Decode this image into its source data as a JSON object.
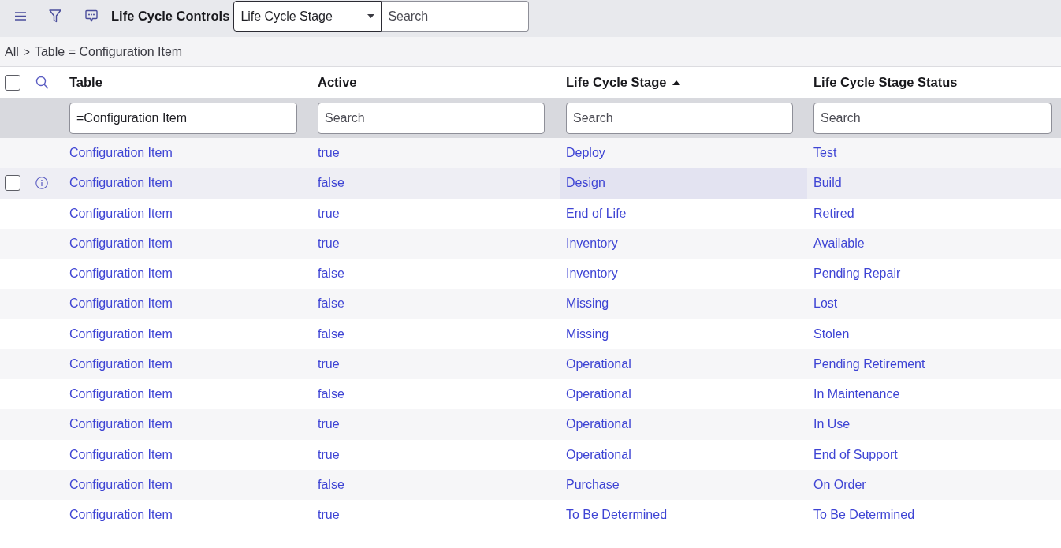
{
  "toolbar": {
    "title": "Life Cycle Controls",
    "field_select": {
      "value": "Life Cycle Stage"
    },
    "search": {
      "placeholder": "Search"
    }
  },
  "breadcrumb": {
    "items": [
      "All",
      "Table = Configuration Item"
    ],
    "separator": ">"
  },
  "table": {
    "select_all": {
      "checked": false
    },
    "columns": [
      {
        "label": "Table",
        "sorted": false
      },
      {
        "label": "Active",
        "sorted": false
      },
      {
        "label": "Life Cycle Stage",
        "sorted": true
      },
      {
        "label": "Life Cycle Stage Status",
        "sorted": false
      }
    ],
    "filters": [
      {
        "value": "=Configuration Item"
      },
      {
        "placeholder": "Search"
      },
      {
        "placeholder": "Search"
      },
      {
        "placeholder": "Search"
      }
    ],
    "rows": [
      {
        "shaded": true,
        "hovered": false,
        "checked": false,
        "cells": [
          {
            "text": "Configuration Item",
            "focused": false
          },
          {
            "text": "true",
            "focused": false
          },
          {
            "text": "Deploy",
            "focused": false
          },
          {
            "text": "Test",
            "focused": false
          }
        ]
      },
      {
        "shaded": true,
        "hovered": true,
        "checked": false,
        "cells": [
          {
            "text": "Configuration Item",
            "focused": false
          },
          {
            "text": "false",
            "focused": false
          },
          {
            "text": "Design",
            "focused": true
          },
          {
            "text": "Build",
            "focused": false
          }
        ]
      },
      {
        "shaded": false,
        "hovered": false,
        "checked": false,
        "cells": [
          {
            "text": "Configuration Item",
            "focused": false
          },
          {
            "text": "true",
            "focused": false
          },
          {
            "text": "End of Life",
            "focused": false
          },
          {
            "text": "Retired",
            "focused": false
          }
        ]
      },
      {
        "shaded": true,
        "hovered": false,
        "checked": false,
        "cells": [
          {
            "text": "Configuration Item",
            "focused": false
          },
          {
            "text": "true",
            "focused": false
          },
          {
            "text": "Inventory",
            "focused": false
          },
          {
            "text": "Available",
            "focused": false
          }
        ]
      },
      {
        "shaded": false,
        "hovered": false,
        "checked": false,
        "cells": [
          {
            "text": "Configuration Item",
            "focused": false
          },
          {
            "text": "false",
            "focused": false
          },
          {
            "text": "Inventory",
            "focused": false
          },
          {
            "text": "Pending Repair",
            "focused": false
          }
        ]
      },
      {
        "shaded": true,
        "hovered": false,
        "checked": false,
        "cells": [
          {
            "text": "Configuration Item",
            "focused": false
          },
          {
            "text": "false",
            "focused": false
          },
          {
            "text": "Missing",
            "focused": false
          },
          {
            "text": "Lost",
            "focused": false
          }
        ]
      },
      {
        "shaded": false,
        "hovered": false,
        "checked": false,
        "cells": [
          {
            "text": "Configuration Item",
            "focused": false
          },
          {
            "text": "false",
            "focused": false
          },
          {
            "text": "Missing",
            "focused": false
          },
          {
            "text": "Stolen",
            "focused": false
          }
        ]
      },
      {
        "shaded": true,
        "hovered": false,
        "checked": false,
        "cells": [
          {
            "text": "Configuration Item",
            "focused": false
          },
          {
            "text": "true",
            "focused": false
          },
          {
            "text": "Operational",
            "focused": false
          },
          {
            "text": "Pending Retirement",
            "focused": false
          }
        ]
      },
      {
        "shaded": false,
        "hovered": false,
        "checked": false,
        "cells": [
          {
            "text": "Configuration Item",
            "focused": false
          },
          {
            "text": "false",
            "focused": false
          },
          {
            "text": "Operational",
            "focused": false
          },
          {
            "text": "In Maintenance",
            "focused": false
          }
        ]
      },
      {
        "shaded": true,
        "hovered": false,
        "checked": false,
        "cells": [
          {
            "text": "Configuration Item",
            "focused": false
          },
          {
            "text": "true",
            "focused": false
          },
          {
            "text": "Operational",
            "focused": false
          },
          {
            "text": "In Use",
            "focused": false
          }
        ]
      },
      {
        "shaded": false,
        "hovered": false,
        "checked": false,
        "cells": [
          {
            "text": "Configuration Item",
            "focused": false
          },
          {
            "text": "true",
            "focused": false
          },
          {
            "text": "Operational",
            "focused": false
          },
          {
            "text": "End of Support",
            "focused": false
          }
        ]
      },
      {
        "shaded": true,
        "hovered": false,
        "checked": false,
        "cells": [
          {
            "text": "Configuration Item",
            "focused": false
          },
          {
            "text": "false",
            "focused": false
          },
          {
            "text": "Purchase",
            "focused": false
          },
          {
            "text": "On Order",
            "focused": false
          }
        ]
      },
      {
        "shaded": false,
        "hovered": false,
        "checked": false,
        "cells": [
          {
            "text": "Configuration Item",
            "focused": false
          },
          {
            "text": "true",
            "focused": false
          },
          {
            "text": "To Be Determined",
            "focused": false
          },
          {
            "text": "To Be Determined",
            "focused": false
          }
        ]
      }
    ]
  }
}
